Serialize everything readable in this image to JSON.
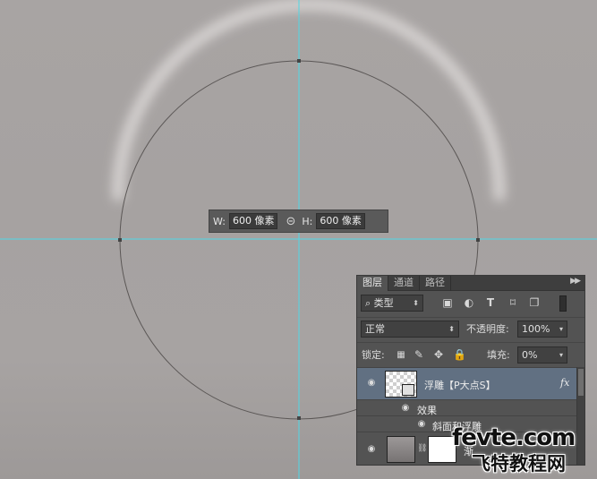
{
  "size_readout": {
    "width_label": "W:",
    "width_value": "600 像素",
    "height_label": "H:",
    "height_value": "600 像素",
    "link_icon": "link-icon"
  },
  "layers_panel": {
    "tabs": [
      {
        "label": "图层",
        "active": true
      },
      {
        "label": "通道",
        "active": false
      },
      {
        "label": "路径",
        "active": false
      }
    ],
    "filter": {
      "kind_label": "类型",
      "icons": [
        "image-filter-icon",
        "adjustment-filter-icon",
        "type-filter-icon",
        "shape-filter-icon",
        "smart-object-filter-icon"
      ]
    },
    "blend_mode": "正常",
    "opacity_label": "不透明度:",
    "opacity_value": "100%",
    "lock_label": "锁定:",
    "fill_label": "填充:",
    "fill_value": "0%",
    "layers": [
      {
        "name": "浮雕【P大点S】",
        "fx": "fx",
        "selected": true
      },
      {
        "effects_label": "效果"
      },
      {
        "effect_name": "斜面和浮雕"
      },
      {
        "name": "渐"
      }
    ]
  },
  "watermark": {
    "line1": "fevte.com",
    "line2": "飞特教程网"
  },
  "colors": {
    "guide": "#4fd8e6",
    "selected_layer": "#617082"
  }
}
